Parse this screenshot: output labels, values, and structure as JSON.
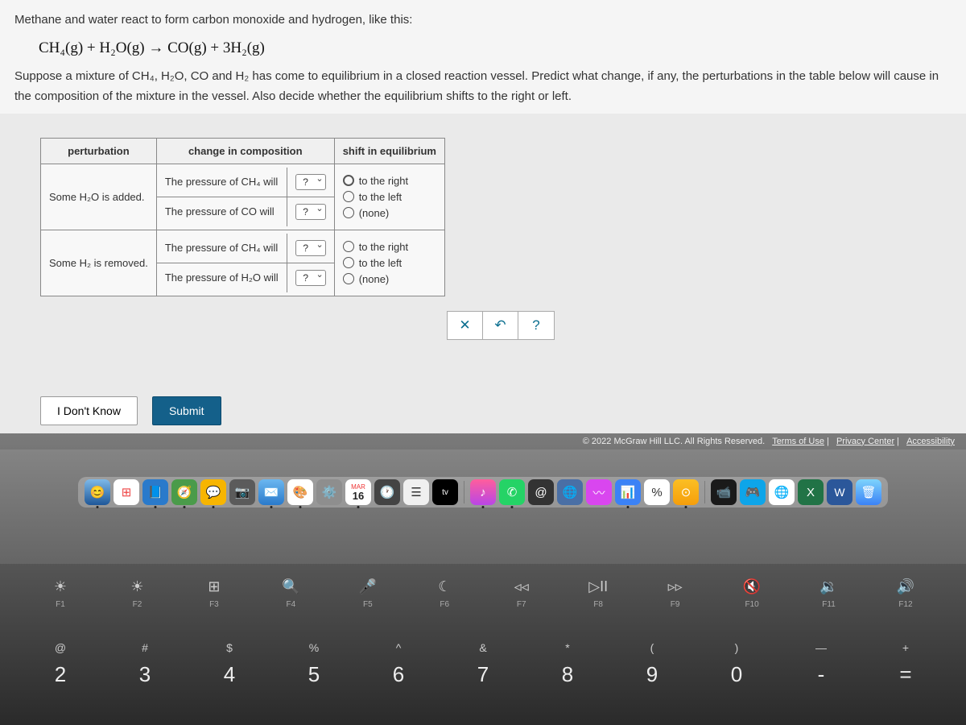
{
  "question": {
    "intro": "Methane and water react to form carbon monoxide and hydrogen, like this:",
    "equation_left": "CH₄(g) + H₂O(g)",
    "equation_arrow": "→",
    "equation_right": "CO(g) + 3H₂(g)",
    "body1": "Suppose a mixture of CH₄, H₂O, CO and H₂ has come to equilibrium in a closed reaction vessel. Predict what change, if any, the perturbations in the table below will cause in the composition of the mixture in the vessel. Also decide whether the equilibrium shifts to the right or left."
  },
  "table": {
    "headers": {
      "c1": "perturbation",
      "c2": "change in composition",
      "c3": "shift in equilibrium"
    },
    "rows": [
      {
        "perturbation": "Some H₂O is added.",
        "comp": [
          {
            "label": "The pressure of CH₄ will",
            "value": "?"
          },
          {
            "label": "The pressure of CO will",
            "value": "?"
          }
        ],
        "shift": [
          "to the right",
          "to the left",
          "(none)"
        ]
      },
      {
        "perturbation": "Some H₂ is removed.",
        "comp": [
          {
            "label": "The pressure of CH₄ will",
            "value": "?"
          },
          {
            "label": "The pressure of H₂O will",
            "value": "?"
          }
        ],
        "shift": [
          "to the right",
          "to the left",
          "(none)"
        ]
      }
    ]
  },
  "toolbar": {
    "clear": "✕",
    "undo": "↶",
    "help": "?"
  },
  "buttons": {
    "idk": "I Don't Know",
    "submit": "Submit"
  },
  "footer": {
    "copyright": "© 2022 McGraw Hill LLC. All Rights Reserved.",
    "links": [
      "Terms of Use",
      "Privacy Center",
      "Accessibility"
    ]
  },
  "dock": {
    "calendar": {
      "month": "MAR",
      "day": "16"
    },
    "tv": "tv"
  },
  "fnkeys": [
    {
      "icon": "☀",
      "label": "F1"
    },
    {
      "icon": "☀",
      "label": "F2"
    },
    {
      "icon": "⊞",
      "label": "F3"
    },
    {
      "icon": "🔍",
      "label": "F4"
    },
    {
      "icon": "🎤",
      "label": "F5"
    },
    {
      "icon": "☾",
      "label": "F6"
    },
    {
      "icon": "◃◃",
      "label": "F7"
    },
    {
      "icon": "▷II",
      "label": "F8"
    },
    {
      "icon": "▹▹",
      "label": "F9"
    },
    {
      "icon": "🔇",
      "label": "F10"
    },
    {
      "icon": "🔉",
      "label": "F11"
    },
    {
      "icon": "🔊",
      "label": "F12"
    }
  ],
  "numkeys": [
    {
      "sym": "@",
      "num": "2"
    },
    {
      "sym": "#",
      "num": "3"
    },
    {
      "sym": "$",
      "num": "4"
    },
    {
      "sym": "%",
      "num": "5"
    },
    {
      "sym": "^",
      "num": "6"
    },
    {
      "sym": "&",
      "num": "7"
    },
    {
      "sym": "*",
      "num": "8"
    },
    {
      "sym": "(",
      "num": "9"
    },
    {
      "sym": ")",
      "num": "0"
    },
    {
      "sym": "—",
      "num": "-"
    },
    {
      "sym": "+",
      "num": "="
    }
  ]
}
